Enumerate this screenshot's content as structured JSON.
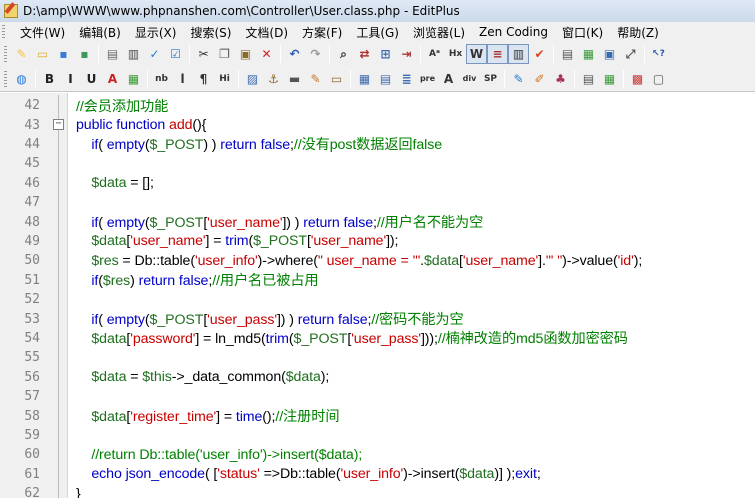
{
  "window": {
    "title": "D:\\amp\\WWW\\www.phpnanshen.com\\Controller\\User.class.php - EditPlus"
  },
  "menu": {
    "items": [
      "文件(W)",
      "编辑(B)",
      "显示(X)",
      "搜索(S)",
      "文档(D)",
      "方案(F)",
      "工具(G)",
      "浏览器(L)",
      "Zen Coding",
      "窗口(K)",
      "帮助(Z)"
    ]
  },
  "toolbar1": {
    "buttons": [
      {
        "name": "new-file-icon",
        "glyph": "✎",
        "color": "#f6c342"
      },
      {
        "name": "open-folder-icon",
        "glyph": "▭",
        "color": "#e2b13c"
      },
      {
        "name": "save-icon",
        "glyph": "▪",
        "color": "#3a7bd5"
      },
      {
        "name": "save-all-icon",
        "glyph": "▪",
        "color": "#3a9a5a"
      },
      {
        "sep": true
      },
      {
        "name": "print-preview-icon",
        "glyph": "▤",
        "color": "#6a6a6a"
      },
      {
        "name": "print-icon",
        "glyph": "▥",
        "color": "#4a4a4a"
      },
      {
        "name": "spell-check-icon",
        "glyph": "✓",
        "color": "#2a7ad2"
      },
      {
        "name": "check-icon",
        "glyph": "☑",
        "color": "#2a7ad2"
      },
      {
        "sep": true
      },
      {
        "name": "cut-icon",
        "glyph": "✂",
        "color": "#333333"
      },
      {
        "name": "copy-icon",
        "glyph": "❐",
        "color": "#555555"
      },
      {
        "name": "paste-icon",
        "glyph": "▣",
        "color": "#8a6a2a"
      },
      {
        "name": "delete-icon",
        "glyph": "✕",
        "color": "#cc2222"
      },
      {
        "sep": true
      },
      {
        "name": "undo-icon",
        "glyph": "↶",
        "color": "#2a5ab0"
      },
      {
        "name": "redo-icon",
        "glyph": "↷",
        "color": "#999999"
      },
      {
        "sep": true
      },
      {
        "name": "find-icon",
        "glyph": "⌕",
        "color": "#333333"
      },
      {
        "name": "replace-icon",
        "glyph": "⇄",
        "color": "#aa3333"
      },
      {
        "name": "find-in-files-icon",
        "glyph": "⊞",
        "color": "#3a6ab0"
      },
      {
        "name": "goto-line-icon",
        "glyph": "⇥",
        "color": "#aa3333"
      },
      {
        "sep": true
      },
      {
        "name": "font-icon",
        "glyph": "Aᵃ",
        "color": "#333333"
      },
      {
        "name": "hex-icon",
        "glyph": "Hx",
        "color": "#333333"
      },
      {
        "name": "word-wrap-icon",
        "glyph": "W",
        "color": "#333333",
        "toggled": true
      },
      {
        "name": "line-number-icon",
        "glyph": "≡",
        "color": "#aa3333",
        "toggled": true
      },
      {
        "name": "ruler-icon",
        "glyph": "▥",
        "color": "#333333",
        "toggled": true
      },
      {
        "name": "syntax-check-icon",
        "glyph": "✔",
        "color": "#dd4422"
      },
      {
        "sep": true
      },
      {
        "name": "output-window-icon",
        "glyph": "▤",
        "color": "#555555"
      },
      {
        "name": "directory-window-icon",
        "glyph": "▦",
        "color": "#3a9a3a"
      },
      {
        "name": "cliptext-window-icon",
        "glyph": "▣",
        "color": "#3a6ab0"
      },
      {
        "name": "fullscreen-icon",
        "glyph": "⤢",
        "color": "#555555"
      },
      {
        "sep": true
      },
      {
        "name": "help-pointer-icon",
        "glyph": "↖?",
        "color": "#2a5ab0"
      }
    ]
  },
  "toolbar2": {
    "buttons": [
      {
        "name": "browser-icon",
        "glyph": "◍",
        "color": "#2a7ad2"
      },
      {
        "sep": true
      },
      {
        "name": "bold-icon",
        "glyph": "B",
        "color": "#222222"
      },
      {
        "name": "italic-icon",
        "glyph": "I",
        "color": "#222222"
      },
      {
        "name": "underline-icon",
        "glyph": "U",
        "color": "#222222"
      },
      {
        "name": "font-color-icon",
        "glyph": "A",
        "color": "#cc2222"
      },
      {
        "name": "color-picker-icon",
        "glyph": "▦",
        "color": "#3a9a3a"
      },
      {
        "sep": true
      },
      {
        "name": "nbsp-icon",
        "glyph": "nb",
        "color": "#333333"
      },
      {
        "name": "line-break-icon",
        "glyph": "l",
        "color": "#333333"
      },
      {
        "name": "paragraph-icon",
        "glyph": "¶",
        "color": "#333333"
      },
      {
        "name": "heading-icon",
        "glyph": "Hi",
        "color": "#333333"
      },
      {
        "sep": true
      },
      {
        "name": "image-icon",
        "glyph": "▨",
        "color": "#3a6ab0"
      },
      {
        "name": "anchor-icon",
        "glyph": "⚓",
        "color": "#8a6a2a"
      },
      {
        "name": "horizontal-rule-icon",
        "glyph": "▬",
        "color": "#555555"
      },
      {
        "name": "edit-icon",
        "glyph": "✎",
        "color": "#cc7722"
      },
      {
        "name": "comment-icon",
        "glyph": "▭",
        "color": "#8a6a2a"
      },
      {
        "sep": true
      },
      {
        "name": "table-icon",
        "glyph": "▦",
        "color": "#3a6ab0"
      },
      {
        "name": "table-row-icon",
        "glyph": "▤",
        "color": "#3a6ab0"
      },
      {
        "name": "align-center-icon",
        "glyph": "≣",
        "color": "#3a6ab0"
      },
      {
        "name": "pre-icon",
        "glyph": "pre",
        "color": "#333333"
      },
      {
        "name": "anchor-tag-icon",
        "glyph": "A",
        "color": "#333333"
      },
      {
        "name": "div-icon",
        "glyph": "div",
        "color": "#333333"
      },
      {
        "name": "span-icon",
        "glyph": "SP",
        "color": "#333333"
      },
      {
        "sep": true
      },
      {
        "name": "form-icon",
        "glyph": "✎",
        "color": "#2a7ad2"
      },
      {
        "name": "script-icon",
        "glyph": "✐",
        "color": "#cc7722"
      },
      {
        "name": "style-icon",
        "glyph": "♣",
        "color": "#aa3355"
      },
      {
        "sep": true
      },
      {
        "name": "html-toolbar-icon",
        "glyph": "▤",
        "color": "#555555"
      },
      {
        "name": "css-toolbar-icon",
        "glyph": "▦",
        "color": "#3a9a3a"
      },
      {
        "sep": true
      },
      {
        "name": "color-palette-icon",
        "glyph": "▩",
        "color": "#cc3333"
      },
      {
        "name": "preview-icon",
        "glyph": "▢",
        "color": "#555555"
      }
    ]
  },
  "editor": {
    "colors": {
      "keyword": "#0000c8",
      "variable": "#1f6f1f",
      "string": "#c80000",
      "comment": "#008000"
    },
    "fold_marker": "⊟",
    "lines": [
      {
        "n": "42",
        "tokens": [
          [
            "cmt",
            "//会员添加功能"
          ]
        ]
      },
      {
        "n": "43",
        "fold": true,
        "tokens": [
          [
            "kw",
            "public function "
          ],
          [
            "str",
            "add"
          ],
          [
            "txt",
            "(){"
          ]
        ]
      },
      {
        "n": "44",
        "tokens": [
          [
            "txt",
            "    "
          ],
          [
            "kw",
            "if"
          ],
          [
            "txt",
            "( "
          ],
          [
            "kw",
            "empty"
          ],
          [
            "txt",
            "("
          ],
          [
            "var",
            "$_POST"
          ],
          [
            "txt",
            ") ) "
          ],
          [
            "kw",
            "return false"
          ],
          [
            "txt",
            ";"
          ],
          [
            "cmt",
            "//没有post数据返回false"
          ]
        ]
      },
      {
        "n": "45",
        "tokens": []
      },
      {
        "n": "46",
        "tokens": [
          [
            "txt",
            "    "
          ],
          [
            "var",
            "$data"
          ],
          [
            "txt",
            " = [];"
          ]
        ]
      },
      {
        "n": "47",
        "tokens": []
      },
      {
        "n": "48",
        "tokens": [
          [
            "txt",
            "    "
          ],
          [
            "kw",
            "if"
          ],
          [
            "txt",
            "( "
          ],
          [
            "kw",
            "empty"
          ],
          [
            "txt",
            "("
          ],
          [
            "var",
            "$_POST"
          ],
          [
            "txt",
            "["
          ],
          [
            "str",
            "'user_name'"
          ],
          [
            "txt",
            "]) ) "
          ],
          [
            "kw",
            "return false"
          ],
          [
            "txt",
            ";"
          ],
          [
            "cmt",
            "//用户名不能为空"
          ]
        ]
      },
      {
        "n": "49",
        "tokens": [
          [
            "txt",
            "    "
          ],
          [
            "var",
            "$data"
          ],
          [
            "txt",
            "["
          ],
          [
            "str",
            "'user_name'"
          ],
          [
            "txt",
            "] = "
          ],
          [
            "kw",
            "trim"
          ],
          [
            "txt",
            "("
          ],
          [
            "var",
            "$_POST"
          ],
          [
            "txt",
            "["
          ],
          [
            "str",
            "'user_name'"
          ],
          [
            "txt",
            "]);"
          ]
        ]
      },
      {
        "n": "50",
        "tokens": [
          [
            "txt",
            "    "
          ],
          [
            "var",
            "$res"
          ],
          [
            "txt",
            " = Db::table("
          ],
          [
            "str",
            "'user_info'"
          ],
          [
            "txt",
            ")->where("
          ],
          [
            "str",
            "\" user_name = '\""
          ],
          [
            "txt",
            "."
          ],
          [
            "var",
            "$data"
          ],
          [
            "txt",
            "["
          ],
          [
            "str",
            "'user_name'"
          ],
          [
            "txt",
            "]."
          ],
          [
            "str",
            "\"' \""
          ],
          [
            "txt",
            ")->value("
          ],
          [
            "str",
            "'id'"
          ],
          [
            "txt",
            ");"
          ]
        ]
      },
      {
        "n": "51",
        "tokens": [
          [
            "txt",
            "    "
          ],
          [
            "kw",
            "if"
          ],
          [
            "txt",
            "("
          ],
          [
            "var",
            "$res"
          ],
          [
            "txt",
            ") "
          ],
          [
            "kw",
            "return false"
          ],
          [
            "txt",
            ";"
          ],
          [
            "cmt",
            "//用户名已被占用"
          ]
        ]
      },
      {
        "n": "52",
        "tokens": []
      },
      {
        "n": "53",
        "tokens": [
          [
            "txt",
            "    "
          ],
          [
            "kw",
            "if"
          ],
          [
            "txt",
            "( "
          ],
          [
            "kw",
            "empty"
          ],
          [
            "txt",
            "("
          ],
          [
            "var",
            "$_POST"
          ],
          [
            "txt",
            "["
          ],
          [
            "str",
            "'user_pass'"
          ],
          [
            "txt",
            "]) ) "
          ],
          [
            "kw",
            "return false"
          ],
          [
            "txt",
            ";"
          ],
          [
            "cmt",
            "//密码不能为空"
          ]
        ]
      },
      {
        "n": "54",
        "tokens": [
          [
            "txt",
            "    "
          ],
          [
            "var",
            "$data"
          ],
          [
            "txt",
            "["
          ],
          [
            "str",
            "'password'"
          ],
          [
            "txt",
            "] = ln_md5("
          ],
          [
            "kw",
            "trim"
          ],
          [
            "txt",
            "("
          ],
          [
            "var",
            "$_POST"
          ],
          [
            "txt",
            "["
          ],
          [
            "str",
            "'user_pass'"
          ],
          [
            "txt",
            "]));"
          ],
          [
            "cmt",
            "//楠神改造的md5函数加密密码"
          ]
        ]
      },
      {
        "n": "55",
        "tokens": []
      },
      {
        "n": "56",
        "tokens": [
          [
            "txt",
            "    "
          ],
          [
            "var",
            "$data"
          ],
          [
            "txt",
            " = "
          ],
          [
            "var",
            "$this"
          ],
          [
            "txt",
            "->_data_common("
          ],
          [
            "var",
            "$data"
          ],
          [
            "txt",
            ");"
          ]
        ]
      },
      {
        "n": "57",
        "tokens": []
      },
      {
        "n": "58",
        "tokens": [
          [
            "txt",
            "    "
          ],
          [
            "var",
            "$data"
          ],
          [
            "txt",
            "["
          ],
          [
            "str",
            "'register_time'"
          ],
          [
            "txt",
            "] = "
          ],
          [
            "kw",
            "time"
          ],
          [
            "txt",
            "();"
          ],
          [
            "cmt",
            "//注册时间"
          ]
        ]
      },
      {
        "n": "59",
        "tokens": []
      },
      {
        "n": "60",
        "tokens": [
          [
            "txt",
            "    "
          ],
          [
            "cmt",
            "//return Db::table('user_info')->insert($data);"
          ]
        ]
      },
      {
        "n": "61",
        "tokens": [
          [
            "txt",
            "    "
          ],
          [
            "kw",
            "echo json_encode"
          ],
          [
            "txt",
            "( ["
          ],
          [
            "str",
            "'status'"
          ],
          [
            "txt",
            " =>Db::table("
          ],
          [
            "str",
            "'user_info'"
          ],
          [
            "txt",
            ")->insert("
          ],
          [
            "var",
            "$data"
          ],
          [
            "txt",
            ")] );"
          ],
          [
            "kw",
            "exit"
          ],
          [
            "txt",
            ";"
          ]
        ]
      },
      {
        "n": "62",
        "tokens": [
          [
            "txt",
            "}"
          ]
        ]
      }
    ]
  }
}
